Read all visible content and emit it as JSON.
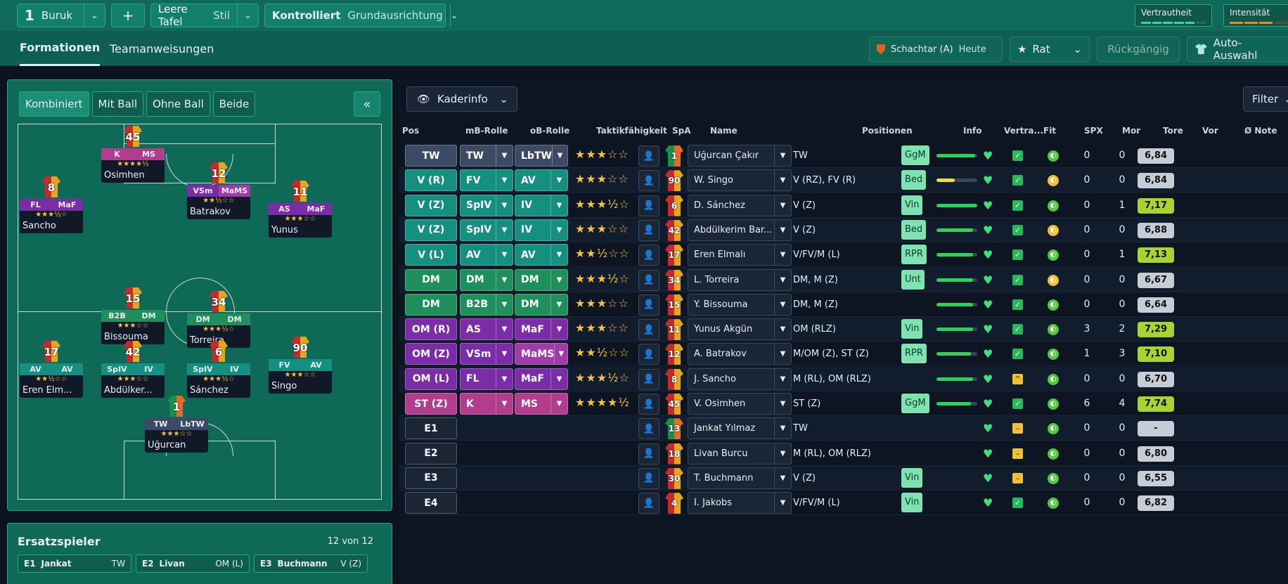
{
  "topbar": {
    "team_number": "1",
    "team_name": "Buruk",
    "add_label": "+",
    "tactic_label": "Leere Tafel",
    "tactic_style": "Stil",
    "mentality_label": "Kontrolliert",
    "mentality_value": "Grundausrichtung",
    "familiarity_label": "Vertrautheit",
    "intensity_label": "Intensität"
  },
  "subbar": {
    "tab_formations": "Formationen",
    "tab_instructions": "Teamanweisungen",
    "next_match_opponent": "Schachtar (A)",
    "next_match_date": "Heute",
    "advice_label": "Rat",
    "undo_label": "Rückgängig",
    "auto_label": "Auto-Auswahl"
  },
  "pitch": {
    "tabs": [
      "Kombiniert",
      "Mit Ball",
      "Ohne Ball",
      "Beide"
    ],
    "collapse_icon": "«",
    "players": [
      {
        "num": "45",
        "r1": "K",
        "r2": "MS",
        "stars": "★★★★½",
        "name": "Osimhen",
        "c1": "#b13d8f",
        "c2": "#b13d8f"
      },
      {
        "num": "8",
        "r1": "FL",
        "r2": "MaF",
        "stars": "★★★½☆",
        "name": "Sancho",
        "c1": "#7b2da8",
        "c2": "#7b2da8"
      },
      {
        "num": "12",
        "r1": "VSm",
        "r2": "MaMS",
        "stars": "★★½☆☆",
        "name": "Batrakov",
        "c1": "#7b2da8",
        "c2": "#a03ca8"
      },
      {
        "num": "11",
        "r1": "AS",
        "r2": "MaF",
        "stars": "★★★☆☆",
        "name": "Yunus",
        "c1": "#7b2da8",
        "c2": "#7b2da8"
      },
      {
        "num": "15",
        "r1": "B2B",
        "r2": "DM",
        "stars": "★★★☆☆",
        "name": "Bissouma",
        "c1": "#1f8f5c",
        "c2": "#1f8f5c"
      },
      {
        "num": "34",
        "r1": "DM",
        "r2": "DM",
        "stars": "★★★½☆",
        "name": "Torreira",
        "c1": "#1f8f5c",
        "c2": "#1f8f5c"
      },
      {
        "num": "17",
        "r1": "AV",
        "r2": "AV",
        "stars": "★★½☆☆",
        "name": "Eren Elm...",
        "c1": "#148f80",
        "c2": "#148f80"
      },
      {
        "num": "42",
        "r1": "SpIV",
        "r2": "IV",
        "stars": "★★★☆☆",
        "name": "Abdülker...",
        "c1": "#148f80",
        "c2": "#148f80"
      },
      {
        "num": "6",
        "r1": "SpIV",
        "r2": "IV",
        "stars": "★★★½☆",
        "name": "Sánchez",
        "c1": "#148f80",
        "c2": "#148f80"
      },
      {
        "num": "90",
        "r1": "FV",
        "r2": "AV",
        "stars": "★★★☆☆",
        "name": "Singo",
        "c1": "#148f80",
        "c2": "#148f80"
      },
      {
        "num": "1",
        "r1": "TW",
        "r2": "LbTW",
        "stars": "★★★☆☆",
        "name": "Uğurcan",
        "c1": "#3d4a66",
        "c2": "#3d4a66"
      }
    ]
  },
  "subs": {
    "title": "Ersatzspieler",
    "count": "12 von 12",
    "items": [
      {
        "slot": "E1",
        "name": "Jankat",
        "pos": "TW"
      },
      {
        "slot": "E2",
        "name": "Livan",
        "pos": "OM (L)"
      },
      {
        "slot": "E3",
        "name": "Buchmann",
        "pos": "V (Z)"
      }
    ]
  },
  "table": {
    "kader_label": "Kaderinfo",
    "filter_label": "Filter",
    "headers": {
      "pos": "Pos",
      "ib": "mB-Rolle",
      "ob": "oB-Rolle",
      "tak": "Taktikfähigkeit",
      "spa": "SpA",
      "name": "Name",
      "positions": "Positionen",
      "info": "Info",
      "vertr": "Vertra...",
      "fit": "Fit",
      "spx": "SPX",
      "mor": "Mor",
      "tore": "Tore",
      "vor": "Vor",
      "note": "Ø Note"
    },
    "rows": [
      {
        "pos": "TW",
        "posColor": "#3d4a66",
        "ib": "TW",
        "ibColor": "#3d4a66",
        "ob": "LbTW",
        "obColor": "#3d4a66",
        "stars": "★★★☆☆",
        "kit": "1",
        "gk": true,
        "name": "Uğurcan Çakır",
        "positions": "TW",
        "info": "GgM",
        "vert": 0.95,
        "spx": "✓",
        "spxWarn": false,
        "mor": "◐",
        "morMid": false,
        "tore": "0",
        "vor": "0",
        "note": "6,84",
        "good": false
      },
      {
        "pos": "V (R)",
        "posColor": "#148f80",
        "ib": "FV",
        "ibColor": "#148f80",
        "ob": "AV",
        "obColor": "#148f80",
        "stars": "★★★☆☆",
        "kit": "90",
        "gk": false,
        "name": "W. Singo",
        "positions": "V (RZ), FV (R)",
        "info": "Bed",
        "vert": 0.45,
        "spx": "✓",
        "spxWarn": false,
        "mor": "◐",
        "morMid": true,
        "tore": "0",
        "vor": "0",
        "note": "6,84",
        "good": false
      },
      {
        "pos": "V (Z)",
        "posColor": "#148f80",
        "ib": "SpIV",
        "ibColor": "#148f80",
        "ob": "IV",
        "obColor": "#148f80",
        "stars": "★★★½☆",
        "kit": "6",
        "gk": false,
        "name": "D. Sánchez",
        "positions": "V (Z)",
        "info": "Vin",
        "vert": 1.0,
        "spx": "✓",
        "spxWarn": false,
        "mor": "◐",
        "morMid": false,
        "tore": "0",
        "vor": "1",
        "note": "7,17",
        "good": true
      },
      {
        "pos": "V (Z)",
        "posColor": "#148f80",
        "ib": "SpIV",
        "ibColor": "#148f80",
        "ob": "IV",
        "obColor": "#148f80",
        "stars": "★★★☆☆",
        "kit": "42",
        "gk": false,
        "name": "Abdülkerim Bar...",
        "positions": "V (Z)",
        "info": "Bed",
        "vert": 0.9,
        "spx": "✓",
        "spxWarn": false,
        "mor": "◐",
        "morMid": true,
        "tore": "0",
        "vor": "0",
        "note": "6,88",
        "good": false
      },
      {
        "pos": "V (L)",
        "posColor": "#148f80",
        "ib": "AV",
        "ibColor": "#148f80",
        "ob": "AV",
        "obColor": "#148f80",
        "stars": "★★½☆☆",
        "kit": "17",
        "gk": false,
        "name": "Eren Elmalı",
        "positions": "V/FV/M (L)",
        "info": "RPR",
        "vert": 0.9,
        "spx": "✓",
        "spxWarn": false,
        "mor": "◐",
        "morMid": false,
        "tore": "0",
        "vor": "1",
        "note": "7,13",
        "good": true
      },
      {
        "pos": "DM",
        "posColor": "#1f8f5c",
        "ib": "DM",
        "ibColor": "#1f8f5c",
        "ob": "DM",
        "obColor": "#1f8f5c",
        "stars": "★★★½☆",
        "kit": "34",
        "gk": false,
        "name": "L. Torreira",
        "positions": "DM, M (Z)",
        "info": "Unt",
        "vert": 0.9,
        "spx": "✓",
        "spxWarn": false,
        "mor": "◐",
        "morMid": true,
        "tore": "0",
        "vor": "0",
        "note": "6,67",
        "good": false
      },
      {
        "pos": "DM",
        "posColor": "#1f8f5c",
        "ib": "B2B",
        "ibColor": "#1f8f5c",
        "ob": "DM",
        "obColor": "#1f8f5c",
        "stars": "★★★☆☆",
        "kit": "15",
        "gk": false,
        "name": "Y. Bissouma",
        "positions": "DM, M (Z)",
        "info": "",
        "vert": 0.9,
        "spx": "✓",
        "spxWarn": false,
        "mor": "◐",
        "morMid": false,
        "tore": "0",
        "vor": "0",
        "note": "6,64",
        "good": false
      },
      {
        "pos": "OM (R)",
        "posColor": "#7b2da8",
        "ib": "AS",
        "ibColor": "#7b2da8",
        "ob": "MaF",
        "obColor": "#7b2da8",
        "stars": "★★★☆☆",
        "kit": "11",
        "gk": false,
        "name": "Yunus Akgün",
        "positions": "OM (RLZ)",
        "info": "Vin",
        "vert": 0.9,
        "spx": "✓",
        "spxWarn": false,
        "mor": "◐",
        "morMid": false,
        "tore": "3",
        "vor": "2",
        "note": "7,29",
        "good": true
      },
      {
        "pos": "OM (Z)",
        "posColor": "#7b2da8",
        "ib": "VSm",
        "ibColor": "#7b2da8",
        "ob": "MaMS",
        "obColor": "#a03ca8",
        "stars": "★★½☆☆",
        "kit": "12",
        "gk": false,
        "name": "A. Batrakov",
        "positions": "M/OM (Z), ST (Z)",
        "info": "RPR",
        "vert": 0.85,
        "spx": "✓",
        "spxWarn": false,
        "mor": "◐",
        "morMid": false,
        "tore": "1",
        "vor": "3",
        "note": "7,10",
        "good": true
      },
      {
        "pos": "OM (L)",
        "posColor": "#7b2da8",
        "ib": "FL",
        "ibColor": "#7b2da8",
        "ob": "MaF",
        "obColor": "#7b2da8",
        "stars": "★★★½☆",
        "kit": "8",
        "gk": false,
        "name": "J. Sancho",
        "positions": "M (RL), OM (RLZ)",
        "info": "",
        "vert": 0.9,
        "spx": "^",
        "spxWarn": true,
        "mor": "◐",
        "morMid": false,
        "tore": "0",
        "vor": "0",
        "note": "6,70",
        "good": false
      },
      {
        "pos": "ST (Z)",
        "posColor": "#b13d8f",
        "ib": "K",
        "ibColor": "#b13d8f",
        "ob": "MS",
        "obColor": "#b13d8f",
        "stars": "★★★★½",
        "kit": "45",
        "gk": false,
        "name": "V. Osimhen",
        "positions": "ST (Z)",
        "info": "GgM",
        "vert": 0.85,
        "spx": "✓",
        "spxWarn": false,
        "mor": "◐",
        "morMid": false,
        "tore": "6",
        "vor": "4",
        "note": "7,74",
        "good": true
      },
      {
        "pos": "E1",
        "posColor": "#1a2535",
        "ib": "",
        "ob": "",
        "stars": "",
        "kit": "13",
        "gk": true,
        "name": "Jankat Yılmaz",
        "positions": "TW",
        "info": "",
        "vert": 0,
        "spx": "–",
        "spxWarn": true,
        "mor": "◐",
        "morMid": false,
        "tore": "0",
        "vor": "0",
        "note": "-",
        "good": false
      },
      {
        "pos": "E2",
        "posColor": "#1a2535",
        "ib": "",
        "ob": "",
        "stars": "",
        "kit": "18",
        "gk": false,
        "name": "Livan Burcu",
        "positions": "M (RL), OM (RLZ)",
        "info": "",
        "vert": 0,
        "spx": "–",
        "spxWarn": true,
        "mor": "◐",
        "morMid": false,
        "tore": "0",
        "vor": "0",
        "note": "6,80",
        "good": false
      },
      {
        "pos": "E3",
        "posColor": "#1a2535",
        "ib": "",
        "ob": "",
        "stars": "",
        "kit": "30",
        "gk": false,
        "name": "T. Buchmann",
        "positions": "V (Z)",
        "info": "Vin",
        "vert": 0,
        "spx": "–",
        "spxWarn": true,
        "mor": "◐",
        "morMid": false,
        "tore": "0",
        "vor": "0",
        "note": "6,55",
        "good": false
      },
      {
        "pos": "E4",
        "posColor": "#1a2535",
        "ib": "",
        "ob": "",
        "stars": "",
        "kit": "4",
        "gk": false,
        "name": "I. Jakobs",
        "positions": "V/FV/M (L)",
        "info": "Vin",
        "vert": 0,
        "spx": "✓",
        "spxWarn": false,
        "mor": "◐",
        "morMid": false,
        "tore": "0",
        "vor": "0",
        "note": "6,82",
        "good": false
      }
    ]
  }
}
